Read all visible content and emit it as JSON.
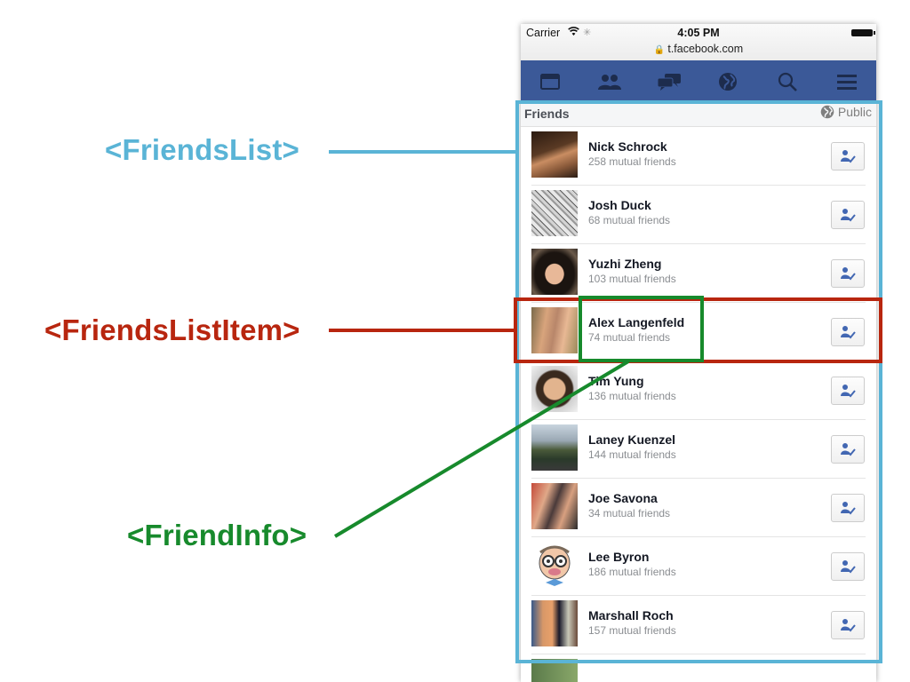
{
  "annotations": {
    "friends_list": "<FriendsList>",
    "friends_list_item": "<FriendsListItem>",
    "friend_info": "<FriendInfo>",
    "colors": {
      "friends_list": "#5ab4d6",
      "friends_list_item": "#b8260f",
      "friend_info": "#178a2c"
    }
  },
  "statusbar": {
    "carrier": "Carrier",
    "time": "4:05 PM",
    "url": "t.facebook.com"
  },
  "navbar": {
    "icons": [
      "news-feed-icon",
      "friends-icon",
      "messages-icon",
      "notifications-globe-icon",
      "search-icon",
      "menu-icon"
    ],
    "color": "#3b5998"
  },
  "section": {
    "title": "Friends",
    "privacy": "Public"
  },
  "friends": [
    {
      "name": "Nick Schrock",
      "mutual": "258 mutual friends"
    },
    {
      "name": "Josh Duck",
      "mutual": "68 mutual friends"
    },
    {
      "name": "Yuzhi Zheng",
      "mutual": "103 mutual friends"
    },
    {
      "name": "Alex Langenfeld",
      "mutual": "74 mutual friends"
    },
    {
      "name": "Tim Yung",
      "mutual": "136 mutual friends"
    },
    {
      "name": "Laney Kuenzel",
      "mutual": "144 mutual friends"
    },
    {
      "name": "Joe Savona",
      "mutual": "34 mutual friends"
    },
    {
      "name": "Lee Byron",
      "mutual": "186 mutual friends"
    },
    {
      "name": "Marshall Roch",
      "mutual": "157 mutual friends"
    }
  ]
}
